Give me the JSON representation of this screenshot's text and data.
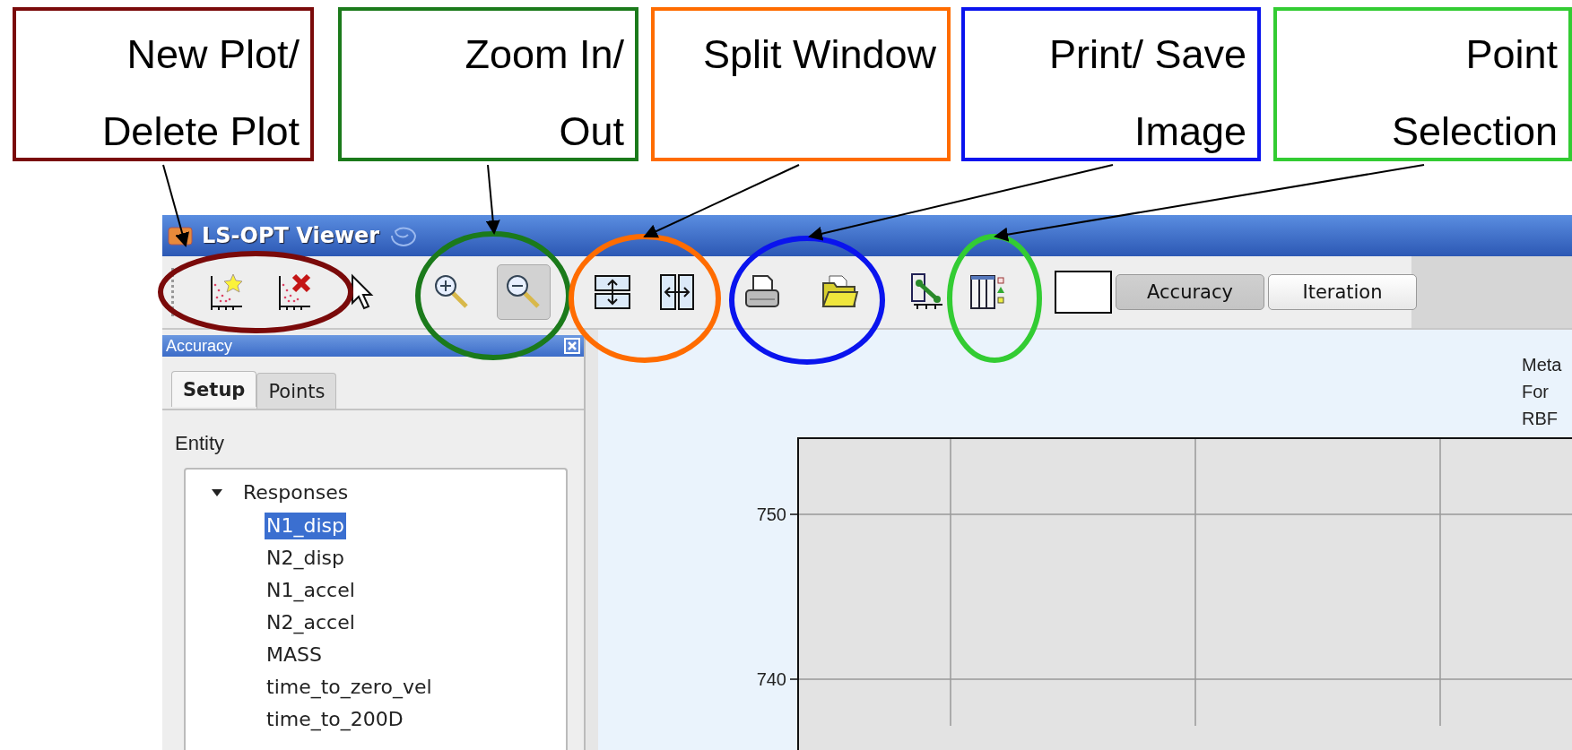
{
  "callouts": [
    {
      "lines": [
        "New Plot/",
        "Delete Plot"
      ],
      "color": "#7a0a0a"
    },
    {
      "lines": [
        "Zoom In/",
        "Out"
      ],
      "color": "#1b7a1b"
    },
    {
      "lines": [
        "Split Window"
      ],
      "color": "#ff6c00"
    },
    {
      "lines": [
        "Print/ Save",
        "Image"
      ],
      "color": "#0a14ee"
    },
    {
      "lines": [
        "Point",
        "Selection"
      ],
      "color": "#33cc33"
    }
  ],
  "window": {
    "title": "LS-OPT Viewer"
  },
  "toolbar": {
    "tools": [
      {
        "pressed": false
      },
      {
        "pressed": false
      },
      {
        "pressed": false
      },
      {
        "pressed": false
      },
      {
        "pressed": true
      },
      {
        "pressed": false
      },
      {
        "pressed": false
      },
      {
        "pressed": false
      },
      {
        "pressed": false
      },
      {
        "pressed": false
      },
      {
        "pressed": false
      }
    ],
    "toggles": [
      {
        "label": "Accuracy",
        "pressed": true
      },
      {
        "label": "Iteration",
        "pressed": false
      }
    ]
  },
  "panel": {
    "title": "Accuracy",
    "tabs": [
      {
        "label": "Setup",
        "selected": true
      },
      {
        "label": "Points",
        "selected": false
      }
    ],
    "entity_label": "Entity",
    "tree": [
      {
        "label": "Responses",
        "expanded": true,
        "selected": false,
        "children": [
          {
            "label": "N1_disp",
            "selected": true
          },
          {
            "label": "N2_disp",
            "selected": false
          },
          {
            "label": "N1_accel",
            "selected": false
          },
          {
            "label": "N2_accel",
            "selected": false
          },
          {
            "label": "MASS",
            "selected": false
          },
          {
            "label": "time_to_zero_vel",
            "selected": false
          },
          {
            "label": "time_to_200D",
            "selected": false
          }
        ]
      }
    ]
  },
  "plot": {
    "title_lines": [
      "Meta",
      "For",
      "RBF"
    ],
    "y_tick_labels": [
      "750",
      "740"
    ]
  }
}
